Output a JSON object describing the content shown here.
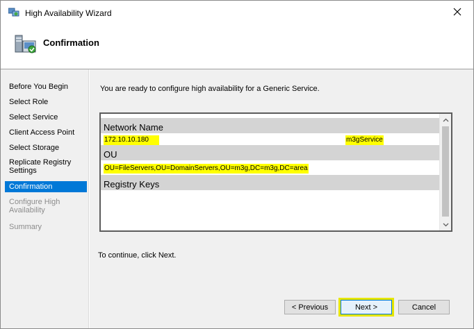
{
  "window": {
    "title": "High Availability Wizard"
  },
  "header": {
    "title": "Confirmation"
  },
  "sidebar": {
    "items": [
      {
        "label": "Before You Begin",
        "state": "normal"
      },
      {
        "label": "Select Role",
        "state": "normal"
      },
      {
        "label": "Select Service",
        "state": "normal"
      },
      {
        "label": "Client Access Point",
        "state": "normal"
      },
      {
        "label": "Select Storage",
        "state": "normal"
      },
      {
        "label": "Replicate Registry Settings",
        "state": "normal"
      },
      {
        "label": "Confirmation",
        "state": "active"
      },
      {
        "label": "Configure High Availability",
        "state": "disabled"
      },
      {
        "label": "Summary",
        "state": "disabled"
      }
    ]
  },
  "main": {
    "intro": "You are ready to configure high availability for a Generic Service.",
    "listbox": {
      "sections": [
        {
          "heading": "Network Name",
          "values": [
            "172.10.10.180",
            "m3gService"
          ]
        },
        {
          "heading": "OU",
          "values": [
            "OU=FileServers,OU=DomainServers,OU=m3g,DC=m3g,DC=area"
          ]
        },
        {
          "heading": "Registry Keys",
          "values": []
        }
      ]
    },
    "continue_text": "To continue, click Next."
  },
  "buttons": {
    "back": "< Previous",
    "next": "Next >",
    "cancel": "Cancel"
  },
  "colors": {
    "accent": "#0078d7",
    "highlight": "#ffff00",
    "section_bg": "#d4d4d4",
    "panel_bg": "#f0f0f0"
  },
  "icons": {
    "title": "wizard-icon",
    "header": "cluster-icon",
    "close": "close-icon",
    "scroll_up": "chevron-up-icon",
    "scroll_down": "chevron-down-icon"
  }
}
